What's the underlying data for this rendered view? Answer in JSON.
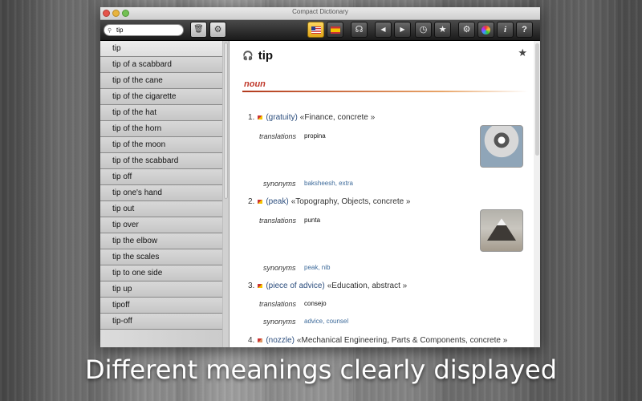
{
  "window": {
    "title": "Compact Dictionary"
  },
  "toolbar": {
    "search_value": "tip",
    "buttons": [
      {
        "name": "delete-button",
        "icon": "trash-icon"
      },
      {
        "name": "search-options-button",
        "icon": "gears-icon"
      },
      {
        "name": "english-flag-button",
        "icon": "us-flag-icon"
      },
      {
        "name": "spanish-flag-button",
        "icon": "spanish-flag-icon"
      },
      {
        "name": "pronounce-button",
        "icon": "headphones-icon"
      },
      {
        "name": "back-button",
        "icon": "chevron-left-icon"
      },
      {
        "name": "forward-button",
        "icon": "chevron-right-icon"
      },
      {
        "name": "history-button",
        "icon": "clock-icon"
      },
      {
        "name": "favorites-button",
        "icon": "star-icon"
      },
      {
        "name": "settings-button",
        "icon": "gear-icon"
      },
      {
        "name": "color-button",
        "icon": "color-wheel-icon"
      },
      {
        "name": "info-button",
        "icon": "info-icon"
      },
      {
        "name": "help-button",
        "icon": "question-icon"
      }
    ]
  },
  "sidebar": {
    "items": [
      "tip",
      "tip of a scabbard",
      "tip of the cane",
      "tip of the cigarette",
      "tip of the hat",
      "tip of the horn",
      "tip of the moon",
      "tip of the scabbard",
      "tip off",
      "tip one's hand",
      "tip out",
      "tip over",
      "tip the elbow",
      "tip the scales",
      "tip to one side",
      "tip up",
      "tipoff",
      "tip-off"
    ],
    "selected_index": 0
  },
  "entry": {
    "headword": "tip",
    "pos": "noun",
    "star": "★",
    "headphones": "🎧",
    "senses": [
      {
        "num": "1.",
        "meaning": "(gratuity)",
        "labels": "«Finance, concrete »",
        "translations_label": "translations",
        "translation": "propina",
        "synonyms_label": "synonyms",
        "synonyms": "baksheesh, extra"
      },
      {
        "num": "2.",
        "meaning": "(peak)",
        "labels": "«Topography, Objects, concrete »",
        "translations_label": "translations",
        "translation": "punta",
        "synonyms_label": "synonyms",
        "synonyms": "peak, nib"
      },
      {
        "num": "3.",
        "meaning": "(piece of advice)",
        "labels": "«Education, abstract »",
        "translations_label": "translations",
        "translation": "consejo",
        "synonyms_label": "synonyms",
        "synonyms": "advice, counsel"
      },
      {
        "num": "4.",
        "meaning": "(nozzle)",
        "labels": "«Mechanical Engineering, Parts & Components, concrete »"
      }
    ]
  },
  "caption": "Different meanings clearly displayed",
  "colors": {
    "pos": "#c0392b",
    "link": "#3d6a9a",
    "toolbar_active": "#f5c040"
  }
}
